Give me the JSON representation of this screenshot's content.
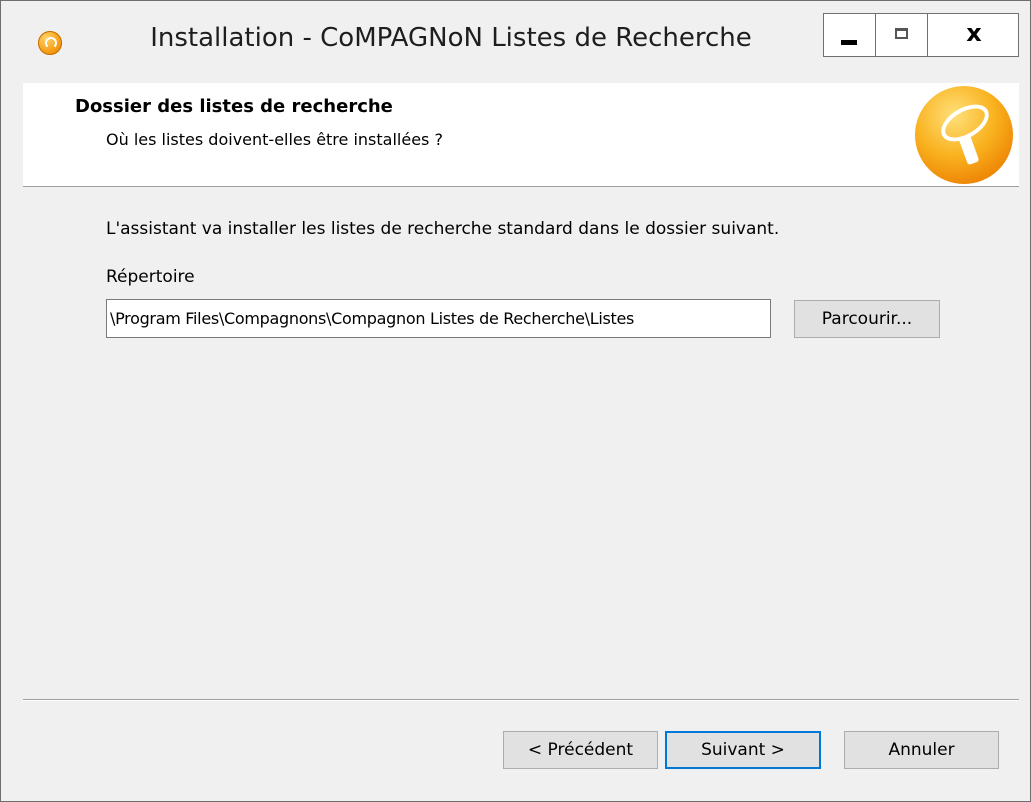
{
  "window": {
    "title": "Installation - CoMPAGNoN Listes de Recherche",
    "buttons": {
      "minimize": "▬",
      "maximize": "□",
      "close": "x"
    }
  },
  "header": {
    "title": "Dossier des listes de recherche",
    "subtitle": "Où les listes doivent-elles être installées ?"
  },
  "body": {
    "description": "L'assistant va installer les listes de recherche standard dans le dossier suivant.",
    "directory_label": "Répertoire",
    "directory_value": "\\Program Files\\Compagnons\\Compagnon Listes de Recherche\\Listes",
    "browse_label": "Parcourir..."
  },
  "footer": {
    "back_label": "< Précédent",
    "next_label": "Suivant >",
    "cancel_label": "Annuler"
  },
  "icons": {
    "app": "compagnon-app-icon",
    "header_logo": "compagnon-logo-icon"
  }
}
